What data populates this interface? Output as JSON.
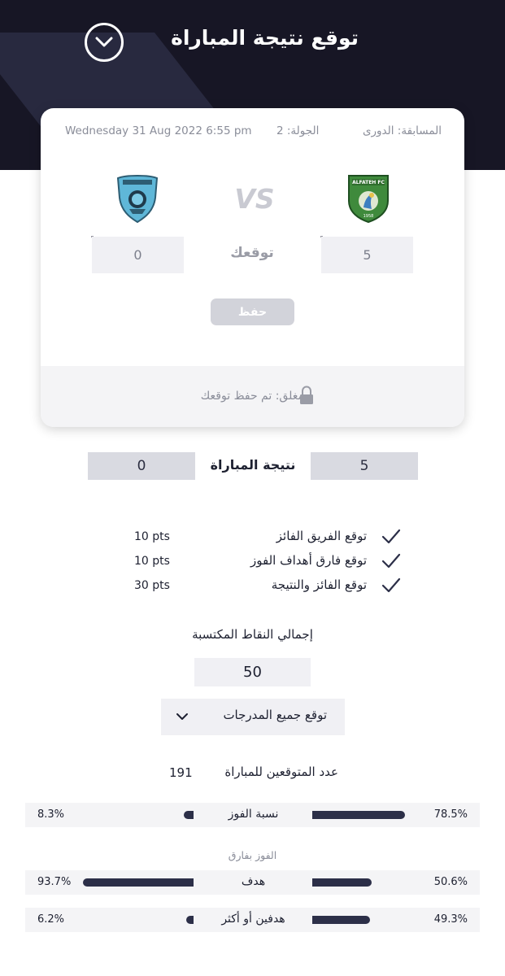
{
  "header": {
    "title": "توقع نتيجة المباراة"
  },
  "match": {
    "competition": "المسابقة: الدورى",
    "round": "الجولة: 2",
    "datetime": "Wednesday  31 Aug  2022 6:55 pm",
    "vs": "VS",
    "home_team_crest": "al-fateh-crest",
    "away_team_crest": "blue-team-crest",
    "home_prediction": "5",
    "away_prediction": "0",
    "prediction_label": "توقعك",
    "save_label": "حفظ",
    "lock_text": "مغلق: تم حفظ توقعك"
  },
  "result": {
    "label": "نتيجة المباراة",
    "home_score": "5",
    "away_score": "0"
  },
  "criteria": [
    {
      "label": "توقع الفريق الفائز",
      "points": "10 pts",
      "icon": "check-icon"
    },
    {
      "label": "توقع فارق أهداف الفوز",
      "points": "10 pts",
      "icon": "check-icon"
    },
    {
      "label": "توقع الفائز والنتيجة",
      "points": "30 pts",
      "icon": "check-icon"
    }
  ],
  "total": {
    "label": "إجمالي النقاط المكتسبة",
    "value": "50"
  },
  "dropdown": {
    "label": "توقع جميع المدرجات"
  },
  "predictors": {
    "label": "عدد المتوقعين للمباراة",
    "count": "191"
  },
  "stats": {
    "win_ratio": {
      "label": "نسبة الفوز",
      "home_pct": "78.5%",
      "away_pct": "8.3%",
      "home_value": 0.785,
      "away_value": 0.083
    },
    "margin_note": "الفوز بفارق",
    "one_goal": {
      "label": "هدف",
      "home_pct": "50.6%",
      "away_pct": "93.7%",
      "home_value": 0.506,
      "away_value": 0.937
    },
    "two_plus": {
      "label": "هدفين أو أكثر",
      "home_pct": "49.3%",
      "away_pct": "6.2%",
      "home_value": 0.493,
      "away_value": 0.062
    }
  },
  "colors": {
    "header_bg": "#171625",
    "bar": "#2c2f48",
    "result_box": "#d9dae1"
  }
}
